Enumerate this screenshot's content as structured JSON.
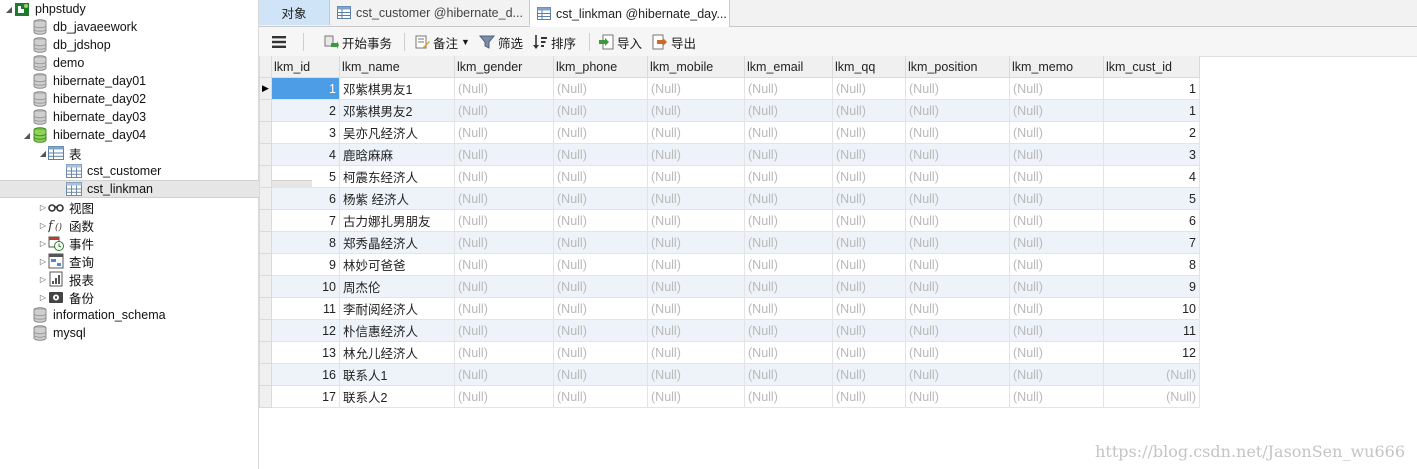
{
  "sidebar": {
    "items": [
      {
        "label": "phpstudy",
        "icon": "connection-icon",
        "level": 0,
        "twisty": "down"
      },
      {
        "label": "db_javaeework",
        "icon": "database-icon",
        "level": 1
      },
      {
        "label": "db_jdshop",
        "icon": "database-icon",
        "level": 1
      },
      {
        "label": "demo",
        "icon": "database-icon",
        "level": 1
      },
      {
        "label": "hibernate_day01",
        "icon": "database-icon",
        "level": 1
      },
      {
        "label": "hibernate_day02",
        "icon": "database-icon",
        "level": 1
      },
      {
        "label": "hibernate_day03",
        "icon": "database-icon",
        "level": 1
      },
      {
        "label": "hibernate_day04",
        "icon": "database-open-icon",
        "level": 1,
        "twisty": "down"
      },
      {
        "label": "表",
        "icon": "tables-icon",
        "level": 2,
        "twisty": "down"
      },
      {
        "label": "cst_customer",
        "icon": "table-icon",
        "level": 3
      },
      {
        "label": "cst_linkman",
        "icon": "table-icon",
        "level": 3,
        "selected": true
      },
      {
        "label": "视图",
        "icon": "views-icon",
        "level": 2,
        "twisty": "right"
      },
      {
        "label": "函数",
        "icon": "function-icon",
        "level": 2,
        "twisty": "right"
      },
      {
        "label": "事件",
        "icon": "event-icon",
        "level": 2,
        "twisty": "right"
      },
      {
        "label": "查询",
        "icon": "query-icon",
        "level": 2,
        "twisty": "right"
      },
      {
        "label": "报表",
        "icon": "report-icon",
        "level": 2,
        "twisty": "right"
      },
      {
        "label": "备份",
        "icon": "backup-icon",
        "level": 2,
        "twisty": "right"
      },
      {
        "label": "information_schema",
        "icon": "database-icon",
        "level": 1
      },
      {
        "label": "mysql",
        "icon": "database-icon",
        "level": 1
      }
    ]
  },
  "tabs": [
    {
      "label": "对象",
      "kind": "objects"
    },
    {
      "label": "cst_customer @hibernate_d...",
      "kind": "inactive"
    },
    {
      "label": "cst_linkman @hibernate_day...",
      "kind": "active"
    }
  ],
  "toolbar": {
    "begin_transaction": "开始事务",
    "memo": "备注",
    "filter": "筛选",
    "sort": "排序",
    "import": "导入",
    "export": "导出"
  },
  "grid": {
    "columns": [
      "lkm_id",
      "lkm_name",
      "lkm_gender",
      "lkm_phone",
      "lkm_mobile",
      "lkm_email",
      "lkm_qq",
      "lkm_position",
      "lkm_memo",
      "lkm_cust_id"
    ],
    "null_text": "(Null)",
    "rows": [
      {
        "id": "1",
        "name": "邓紫棋男友1",
        "cust": "1"
      },
      {
        "id": "2",
        "name": "邓紫棋男友2",
        "cust": "1"
      },
      {
        "id": "3",
        "name": "吴亦凡经济人",
        "cust": "2"
      },
      {
        "id": "4",
        "name": "鹿晗麻麻",
        "cust": "3"
      },
      {
        "id": "5",
        "name": "柯震东经济人",
        "cust": "4"
      },
      {
        "id": "6",
        "name": "杨紫 经济人",
        "cust": "5"
      },
      {
        "id": "7",
        "name": "古力娜扎男朋友",
        "cust": "6"
      },
      {
        "id": "8",
        "name": "郑秀晶经济人",
        "cust": "7"
      },
      {
        "id": "9",
        "name": "林妙可爸爸",
        "cust": "8"
      },
      {
        "id": "10",
        "name": "周杰伦",
        "cust": "9"
      },
      {
        "id": "11",
        "name": "李耐阅经济人",
        "cust": "10"
      },
      {
        "id": "12",
        "name": "朴信惠经济人",
        "cust": "11"
      },
      {
        "id": "13",
        "name": "林允儿经济人",
        "cust": "12"
      },
      {
        "id": "16",
        "name": "联系人1",
        "cust": "(Null)"
      },
      {
        "id": "17",
        "name": "联系人2",
        "cust": "(Null)"
      }
    ]
  },
  "watermark": "https://blog.csdn.net/JasonSen_wu666"
}
